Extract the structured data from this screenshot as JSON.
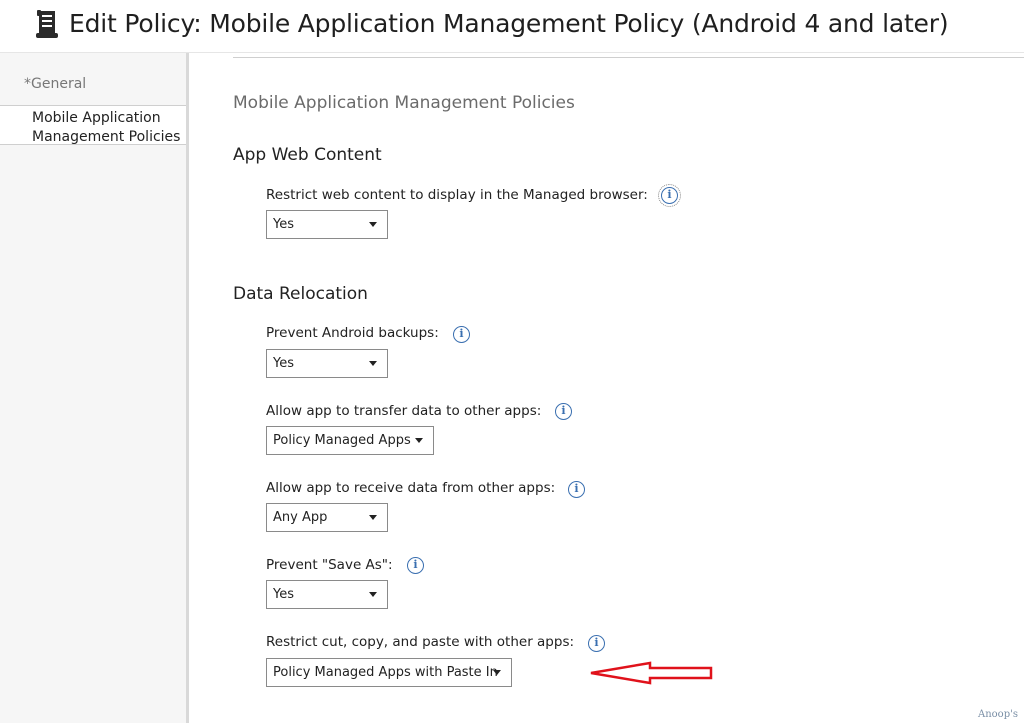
{
  "window": {
    "title": "Edit Policy: Mobile Application Management Policy (Android 4 and later)",
    "title_icon": "policy-scroll-icon"
  },
  "sidebar": {
    "items": [
      {
        "label": "*General"
      },
      {
        "label": "Mobile Application Management Policies",
        "selected": true
      }
    ]
  },
  "main": {
    "section_title": "Mobile Application Management Policies",
    "groups": {
      "app_web_content": {
        "title": "App Web Content",
        "restrict_web": {
          "label": "Restrict web content to display in the Managed browser:",
          "value": "Yes"
        }
      },
      "data_relocation": {
        "title": "Data Relocation",
        "prevent_backups": {
          "label": "Prevent Android backups:",
          "value": "Yes"
        },
        "transfer_data": {
          "label": "Allow app to transfer data to other apps:",
          "value": "Policy Managed Apps"
        },
        "receive_data": {
          "label": "Allow app to receive data from other apps:",
          "value": "Any App"
        },
        "prevent_save_as": {
          "label": "Prevent \"Save As\":",
          "value": "Yes"
        },
        "restrict_clipboard": {
          "label": "Restrict cut, copy, and paste with other apps:",
          "value": "Policy Managed Apps with Paste In"
        }
      }
    }
  },
  "annotation": {
    "arrow_color": "#e0121b"
  },
  "colors": {
    "info_icon": "#3a6fb0",
    "sidebar_bg": "#f6f6f6"
  },
  "watermark": "Anoop's"
}
